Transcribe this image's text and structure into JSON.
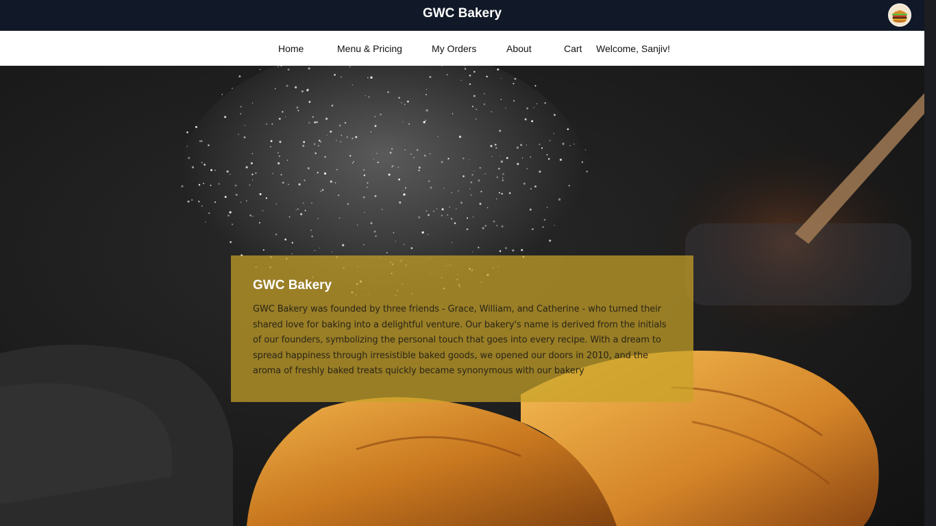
{
  "header": {
    "brand": "GWC Bakery",
    "avatar_icon": "burger-icon"
  },
  "nav": {
    "items": [
      {
        "label": "Home"
      },
      {
        "label": "Menu & Pricing"
      },
      {
        "label": "My Orders"
      },
      {
        "label": "About"
      },
      {
        "label": "Cart"
      }
    ],
    "welcome": "Welcome, Sanjiv!"
  },
  "hero": {
    "title": "GWC Bakery",
    "text": "GWC Bakery was founded by three friends - Grace, William, and Catherine - who turned their shared love for baking into a delightful venture. Our bakery's name is derived from the initials of our founders, symbolizing the personal touch that goes into every recipe. With a dream to spread happiness through irresistible baked goods, we opened our doors in 2010, and the aroma of freshly baked treats quickly became synonymous with our bakery"
  },
  "colors": {
    "topbar": "#111827",
    "nav": "#ffffff",
    "overlay": "#c8a228"
  }
}
